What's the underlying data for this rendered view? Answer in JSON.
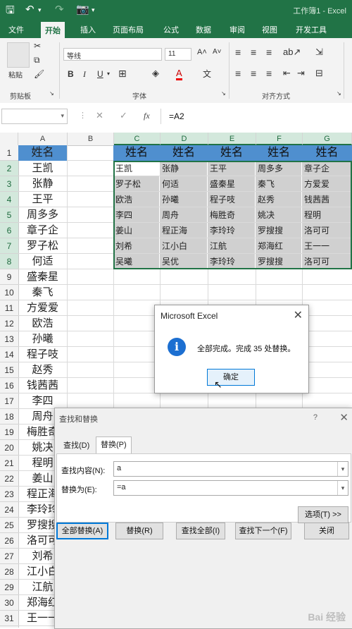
{
  "titlebar": {
    "doc_title": "工作簿1 - Excel"
  },
  "tabs": [
    "文件",
    "开始",
    "插入",
    "页面布局",
    "公式",
    "数据",
    "审阅",
    "视图",
    "开发工具"
  ],
  "ribbon": {
    "clipboard_label": "剪贴板",
    "paste_label": "粘贴",
    "font_name": "等线",
    "font_size": "11",
    "font_label": "字体",
    "align_label": "对齐方式",
    "bold": "B",
    "italic": "I",
    "underline": "U"
  },
  "formula_bar": {
    "formula": "=A2",
    "fx": "fx"
  },
  "columns": [
    "A",
    "B",
    "C",
    "D",
    "E",
    "F",
    "G"
  ],
  "rows": [
    "1",
    "2",
    "3",
    "4",
    "5",
    "6",
    "7",
    "8",
    "9",
    "10",
    "11",
    "12",
    "13",
    "14",
    "15",
    "16",
    "17",
    "18",
    "19",
    "20",
    "21",
    "22",
    "23",
    "24",
    "25",
    "26",
    "27",
    "28",
    "29",
    "30",
    "31"
  ],
  "column_a": [
    "姓名",
    "王凯",
    "张静",
    "王平",
    "周多多",
    "章子企",
    "罗子松",
    "何适",
    "盛秦星",
    "秦飞",
    "方爱爱",
    "欧浩",
    "孙曦",
    "程子吱",
    "赵秀",
    "钱茜茜",
    "李四",
    "周舟",
    "梅胜奇",
    "姚决",
    "程明",
    "姜山",
    "程正海",
    "李玲玲",
    "罗搜搜",
    "洛可可",
    "刘希",
    "江小白",
    "江航",
    "郑海红",
    "王一一"
  ],
  "block_header": [
    "姓名",
    "姓名",
    "姓名",
    "姓名",
    "姓名"
  ],
  "block_rows": [
    [
      "王凯",
      "张静",
      "王平",
      "周多多",
      "章子企"
    ],
    [
      "罗子松",
      "何适",
      "盛秦星",
      "秦飞",
      "方爱爱"
    ],
    [
      "欧浩",
      "孙曦",
      "程子吱",
      "赵秀",
      "钱茜茜"
    ],
    [
      "李四",
      "周舟",
      "梅胜奇",
      "姚决",
      "程明"
    ],
    [
      "姜山",
      "程正海",
      "李玲玲",
      "罗搜搜",
      "洛可可"
    ],
    [
      "刘希",
      "江小白",
      "江航",
      "郑海红",
      "王一一"
    ],
    [
      "吴曦",
      "吴优",
      "李玲玲",
      "罗搜搜",
      "洛可可"
    ]
  ],
  "msgbox": {
    "title": "Microsoft Excel",
    "message": "全部完成。完成 35 处替换。",
    "ok": "确定",
    "icon": "i"
  },
  "find_replace": {
    "title": "查找和替换",
    "help": "?",
    "tab_find": "查找(D)",
    "tab_replace": "替换(P)",
    "find_label": "查找内容(N):",
    "find_value": "a",
    "replace_label": "替换为(E):",
    "replace_value": "=a",
    "options_btn": "选项(T) >>",
    "btn_replace_all": "全部替换(A)",
    "btn_replace": "替换(R)",
    "btn_find_all": "查找全部(I)",
    "btn_find_next": "查找下一个(F)",
    "btn_close": "关闭"
  },
  "watermark": "Bai 经验"
}
